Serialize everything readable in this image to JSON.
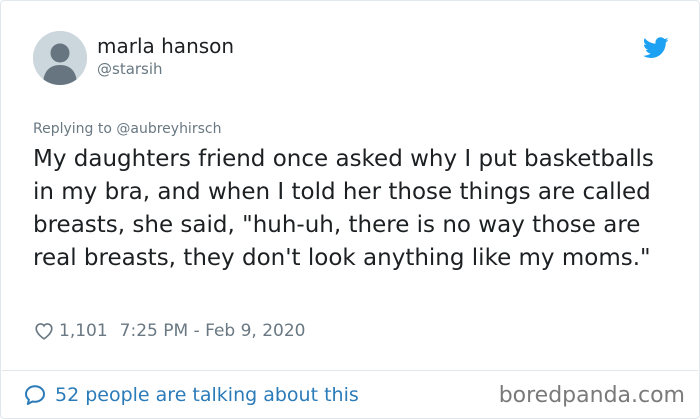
{
  "user": {
    "display_name": "marla hanson",
    "handle": "@starsih",
    "avatar_icon": "default-avatar-icon"
  },
  "brand_icon": "twitter-bird-icon",
  "brand_color": "#1da1f2",
  "reply": {
    "text": "Replying to @aubreyhirsch"
  },
  "tweet": {
    "text": "My daughters friend once asked why I put basketballs in my bra, and when I told her those things are called breasts, she said, \"huh-uh, there is no way those are real breasts, they don't look anything like my moms.\""
  },
  "meta": {
    "like_icon": "heart-outline-icon",
    "likes": "1,101",
    "timestamp": "7:25 PM - Feb 9, 2020"
  },
  "footer": {
    "icon": "speech-bubble-icon",
    "conversation_text": "52 people are talking about this",
    "link_color": "#2b7bb9"
  },
  "watermark": {
    "text": "boredpanda.com"
  }
}
